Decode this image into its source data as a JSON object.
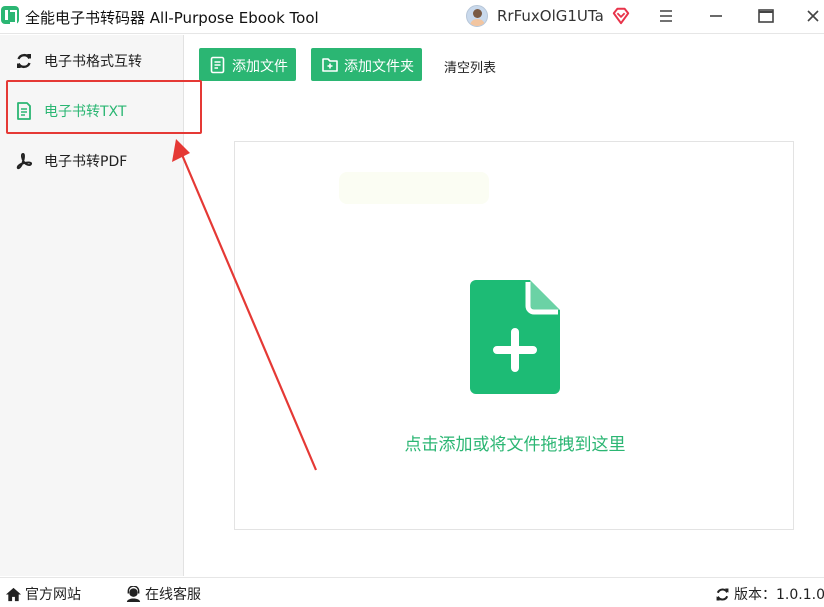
{
  "app": {
    "title": "全能电子书转码器 All-Purpose Ebook Tool",
    "user_name": "RrFuxOlG1UTa"
  },
  "window_controls": [
    "menu-icon",
    "minimize-icon",
    "maximize-icon",
    "close-icon"
  ],
  "sidebar": {
    "items": [
      {
        "label": "电子书格式互转",
        "icon": "refresh-icon",
        "active": false
      },
      {
        "label": "电子书转TXT",
        "icon": "document-icon",
        "active": true
      },
      {
        "label": "电子书转PDF",
        "icon": "pdf-icon",
        "active": false
      }
    ]
  },
  "toolbar": {
    "add_file_label": "添加文件",
    "add_folder_label": "添加文件夹",
    "clear_list_label": "清空列表"
  },
  "dropzone": {
    "hint": "点击添加或将文件拖拽到这里",
    "icon": "add-file-icon"
  },
  "statusbar": {
    "home_label": "官方网站",
    "service_label": "在线客服",
    "version_label": "版本：1.0.1.0"
  },
  "colors": {
    "accent": "#2bb673",
    "annotation": "#e53935",
    "vip": "#e8334a"
  }
}
